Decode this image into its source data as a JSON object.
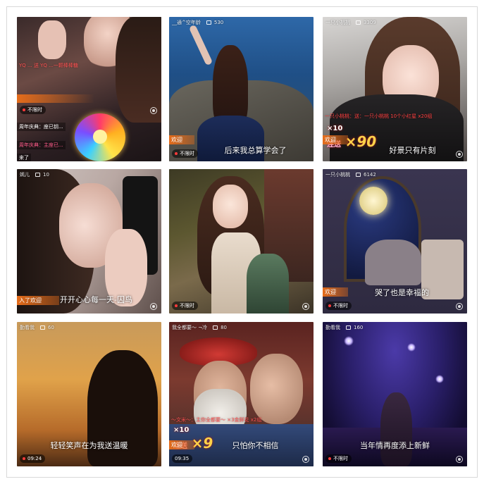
{
  "tiles": [
    {
      "top": {
        "name": "",
        "viewers": ""
      },
      "gift_line": "YQ ... 送 YQ ...一颗棒棒糖",
      "anniv_1": "周年庆典：座已钥...",
      "anniv_2": "周年庆典：主座已...",
      "joined": "来了",
      "badge": "不限时",
      "caption": ""
    },
    {
      "top": {
        "name": "__通^空年龄",
        "viewers": "530"
      },
      "banner": "欢迎",
      "badge": "不限时",
      "caption": "后来我总算学会了"
    },
    {
      "top": {
        "name": "一只小桃桃",
        "viewers": "3309"
      },
      "gift_line": "一只小桃桃：送：一只小桃桃  10个小红星 x20组",
      "combo_times": "×10",
      "combo_label": "连送",
      "combo_count": "×90",
      "banner": "欢迎",
      "badge": "",
      "caption": "好景只有片刻"
    },
    {
      "top": {
        "name": "嫣儿",
        "viewers": "10"
      },
      "banner": "入了欢迎",
      "badge": "",
      "caption": "开开心心每一天-囚鸟"
    },
    {
      "top": {
        "name": "",
        "viewers": ""
      },
      "badge": "不限时",
      "caption": ""
    },
    {
      "top": {
        "name": "一只小桃桃",
        "viewers": "6142"
      },
      "banner": "欢迎",
      "badge": "不限时",
      "caption": "哭了也是幸福的"
    },
    {
      "top": {
        "name": "勤看我",
        "viewers": "60"
      },
      "badge": "09:24",
      "caption": "轻轻笑声在为我送温暖"
    },
    {
      "top": {
        "name": "我全都要～ ¬冷",
        "viewers": "80"
      },
      "gift_line": "～文米～：主你全都要～  ×3金鲜花 x2组",
      "combo_times": "×10",
      "combo_label": "连送",
      "combo_count": "×9",
      "banner": "欢迎",
      "badge": "09:35",
      "caption": "只怕你不相信"
    },
    {
      "top": {
        "name": "勤看我",
        "viewers": "160"
      },
      "badge": "不限时",
      "caption": "当年情再度添上新鲜"
    }
  ],
  "colors": {
    "accent_orange": "#e56c1a",
    "gift_red": "#ff5252",
    "combo_gold": "#ffd24a"
  }
}
